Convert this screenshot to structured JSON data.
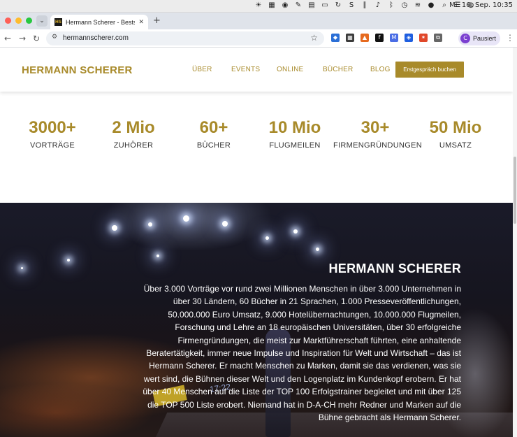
{
  "menubar": {
    "clock": "Mi. 16. Sep.  10:35"
  },
  "browser": {
    "tab_title": "Hermann Scherer - Bestseller",
    "url": "hermannscherer.com",
    "profile_label": "Pausiert",
    "profile_initial": "C"
  },
  "site": {
    "brand": "HERMANN SCHERER",
    "nav": [
      "ÜBER",
      "EVENTS",
      "ONLINE",
      "BÜCHER",
      "BLOG"
    ],
    "cta_label": "Erstgespräch buchen",
    "stats": [
      {
        "value": "3000+",
        "label": "VORTRÄGE"
      },
      {
        "value": "2 Mio",
        "label": "ZUHÖRER"
      },
      {
        "value": "60+",
        "label": "BÜCHER"
      },
      {
        "value": "10 Mio",
        "label": "FLUGMEILEN"
      },
      {
        "value": "30+",
        "label": "FIRMENGRÜNDUNGEN"
      },
      {
        "value": "50 Mio",
        "label": "UMSATZ"
      }
    ],
    "hero": {
      "title": "HERMANN SCHERER",
      "text": "Über 3.000 Vorträge vor rund zwei Millionen Menschen in über 3.000 Unternehmen in über 30 Ländern, 60 Bücher in 21 Sprachen, 1.000 Presseveröffentlichungen, 50.000.000 Euro Umsatz, 9.000 Hotelübernachtungen, 10.000.000 Flugmeilen, Forschung und Lehre an 18 europäischen Universitäten, über 30 erfolgreiche Firmengründungen, die meist zur Marktführerschaft führten, eine anhaltende Beratertätigkeit, immer neue Impulse und Inspiration für Welt und Wirtschaft – das ist Hermann Scherer. Er macht Menschen zu Marken, damit sie das verdienen, was sie wert sind, die Bühnen dieser Welt und den Logenplatz im Kundenkopf erobern. Er hat über 40 Menschen auf die Liste der TOP 100 Erfolgstrainer begleitet und mit über 125 die TOP 500 Liste erobert. Niemand hat in D-A-CH mehr Redner und Marken auf die Bühne gebracht als Hermann Scherer.",
      "stage_clock": "17:22"
    }
  }
}
